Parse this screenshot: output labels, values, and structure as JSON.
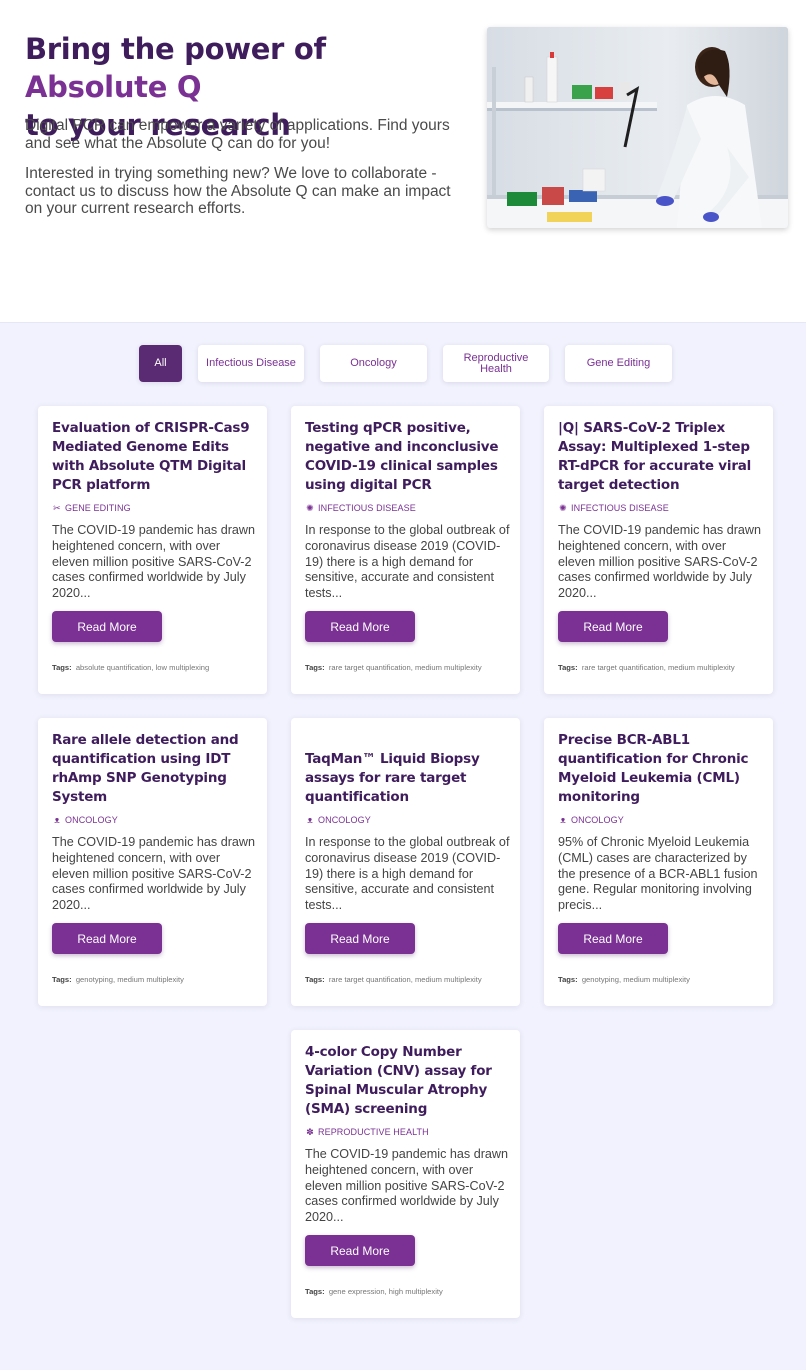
{
  "hero": {
    "title_part1": "Bring the power of ",
    "title_accent": "Absolute Q",
    "title_part2": "to your research",
    "p1": "Digital PCR can empower a variety of applications. Find yours and see what the Absolute Q can do for you!",
    "p2": "Interested in trying something new? We love to collaborate - contact us to discuss how the Absolute Q can make an impact on your current research efforts.",
    "photo_desc": "lab-scientist-photo"
  },
  "filters": [
    {
      "label": "All",
      "active": true
    },
    {
      "label": "Infectious Disease",
      "active": false
    },
    {
      "label": "Oncology",
      "active": false
    },
    {
      "label": "Reproductive Health",
      "active": false
    },
    {
      "label": "Gene Editing",
      "active": false
    }
  ],
  "cards": [
    {
      "title": "Evaluation of CRISPR-Cas9 Mediated Genome Edits with Absolute QTM Digital PCR platform",
      "category": "GENE EDITING",
      "icon": "scissors-icon",
      "description": "The COVID-19 pandemic has drawn heightened concern, with over eleven million positive SARS-CoV-2 cases confirmed worldwide by July 2020...",
      "button": "Read More",
      "tags_label": "Tags:",
      "tags": "absolute quantification, low multiplexing"
    },
    {
      "title": "Testing qPCR positive, negative and inconclusive COVID-19 clinical samples using digital PCR",
      "category": "INFECTIOUS DISEASE",
      "icon": "virus-icon",
      "description": "In response to the global outbreak of coronavirus disease 2019 (COVID-19) there is a high demand for sensitive, accurate and consistent tests...",
      "button": "Read More",
      "tags_label": "Tags:",
      "tags": "rare target quantification, medium multiplexity"
    },
    {
      "title": "|Q| SARS-CoV-2 Triplex Assay: Multiplexed 1-step RT-dPCR for accurate viral target detection",
      "category": "INFECTIOUS DISEASE",
      "icon": "virus-icon",
      "description": "The COVID-19 pandemic has drawn heightened concern, with over eleven million positive SARS-CoV-2 cases confirmed worldwide by July 2020...",
      "button": "Read More",
      "tags_label": "Tags:",
      "tags": "rare target quantification, medium multiplexity"
    },
    {
      "title": "Rare allele detection and quantification using IDT rhAmp SNP Genotyping System",
      "category": "ONCOLOGY",
      "icon": "ribbon-icon",
      "description": "The COVID-19 pandemic has drawn heightened concern, with over eleven million positive SARS-CoV-2 cases confirmed worldwide by July 2020...",
      "button": "Read More",
      "tags_label": "Tags:",
      "tags": "genotyping, medium multiplexity"
    },
    {
      "title": "TaqMan™ Liquid Biopsy assays for rare target quantification",
      "category": "ONCOLOGY",
      "icon": "ribbon-icon",
      "description": "In response to the global outbreak of coronavirus disease 2019 (COVID-19) there is a high demand for sensitive, accurate and consistent tests...",
      "button": "Read More",
      "tags_label": "Tags:",
      "tags": "rare target quantification, medium multiplexity"
    },
    {
      "title": "Precise BCR-ABL1 quantification for Chronic Myeloid Leukemia (CML) monitoring",
      "category": "ONCOLOGY",
      "icon": "ribbon-icon",
      "description": "95% of Chronic Myeloid Leukemia (CML) cases are characterized by the presence of a BCR-ABL1 fusion gene. Regular monitoring involving precis...",
      "button": "Read More",
      "tags_label": "Tags:",
      "tags": "genotyping, medium multiplexity"
    },
    {
      "title": "4-color Copy Number Variation (CNV) assay for Spinal Muscular Atrophy (SMA) screening",
      "category": "REPRODUCTIVE HEALTH",
      "icon": "reproductive-icon",
      "description": "The COVID-19 pandemic has drawn heightened concern, with over eleven million positive SARS-CoV-2 cases confirmed worldwide by July 2020...",
      "button": "Read More",
      "tags_label": "Tags:",
      "tags": "gene expression, high multiplexity"
    }
  ],
  "colors": {
    "brand_dark": "#3f1d5c",
    "brand_accent": "#7a3193",
    "active_filter": "#5a2a72",
    "section_bg": "#f1f2fd"
  }
}
